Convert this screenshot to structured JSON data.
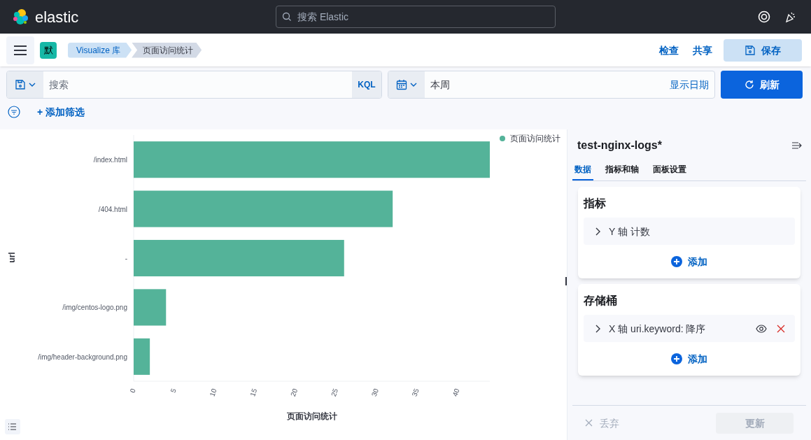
{
  "header": {
    "logo_text": "elastic",
    "search": {
      "placeholder": "搜索 Elastic"
    }
  },
  "nav": {
    "space_badge": "默",
    "breadcrumbs": [
      {
        "label": "Visualize 库",
        "selected": false
      },
      {
        "label": "页面访问统计",
        "selected": true
      }
    ],
    "actions": [
      "检查",
      "共享"
    ],
    "save_button": "保存"
  },
  "query_bar": {
    "search": {
      "placeholder": "搜索"
    },
    "language": "KQL",
    "time_range": "本周",
    "show_dates": "显示日期",
    "refresh_button": "刷新"
  },
  "filter_bar": {
    "add_filter": "+ 添加筛选"
  },
  "chart": {
    "chart_data": {
      "type": "bar",
      "orientation": "horizontal",
      "xlabel": "页面访问统计",
      "ylabel": "url",
      "categories": [
        "/index.html",
        "/404.html",
        "-",
        "/img/centos-logo.png",
        "/img/header-background.png"
      ],
      "series": [
        {
          "name": "页面访问统计",
          "color": "#54b399",
          "values": [
            44,
            32,
            26,
            4,
            2
          ]
        }
      ],
      "xlim": [
        0,
        44
      ],
      "xticks": [
        0,
        5,
        10,
        15,
        20,
        25,
        30,
        35,
        40
      ]
    }
  },
  "sidebar": {
    "title": "test-nginx-logs*",
    "tabs": [
      {
        "label": "数据",
        "selected": true
      },
      {
        "label": "指标和轴",
        "selected": false
      },
      {
        "label": "面板设置",
        "selected": false
      }
    ],
    "sections": [
      {
        "title": "指标",
        "items": [
          {
            "label": "Y 轴 计数",
            "removable": false
          }
        ],
        "add_button": "添加"
      },
      {
        "title": "存储桶",
        "items": [
          {
            "label": "X 轴 uri.keyword: 降序",
            "removable": true
          }
        ],
        "add_button": "添加"
      }
    ],
    "discard_button": "丢弃",
    "update_button": {
      "label": "更新",
      "disabled": true
    }
  }
}
